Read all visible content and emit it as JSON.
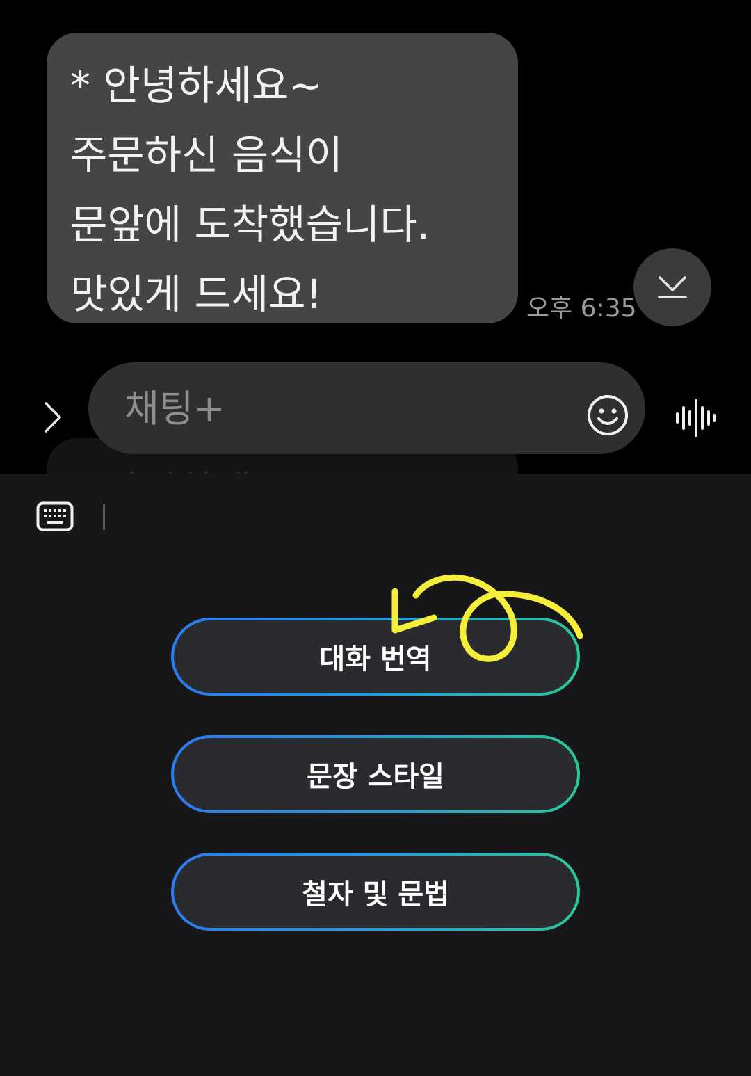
{
  "message": {
    "lines": [
      "* 안녕하세요~",
      "주문하신 음식이",
      "문앞에 도착했습니다.",
      "맛있게 드세요!"
    ],
    "time": "오후 6:35"
  },
  "ghost_message": {
    "preview": "* 안녕하세요~"
  },
  "composer": {
    "placeholder": "채팅+",
    "value": ""
  },
  "icons": {
    "expand": "chevron-right-icon",
    "scroll_down": "scroll-to-bottom-icon",
    "emoji": "smiley-icon",
    "voice": "voice-waveform-icon",
    "keyboard": "keyboard-icon"
  },
  "ai_tools": {
    "buttons": [
      {
        "label": "대화 번역"
      },
      {
        "label": "문장 스타일"
      },
      {
        "label": "철자 및 문법"
      }
    ]
  },
  "colors": {
    "bubble": "#454545",
    "panel": "#17171a",
    "gradient_start": "#2d7bf0",
    "gradient_end": "#2cc69a",
    "annotation": "#f5ee3a"
  }
}
